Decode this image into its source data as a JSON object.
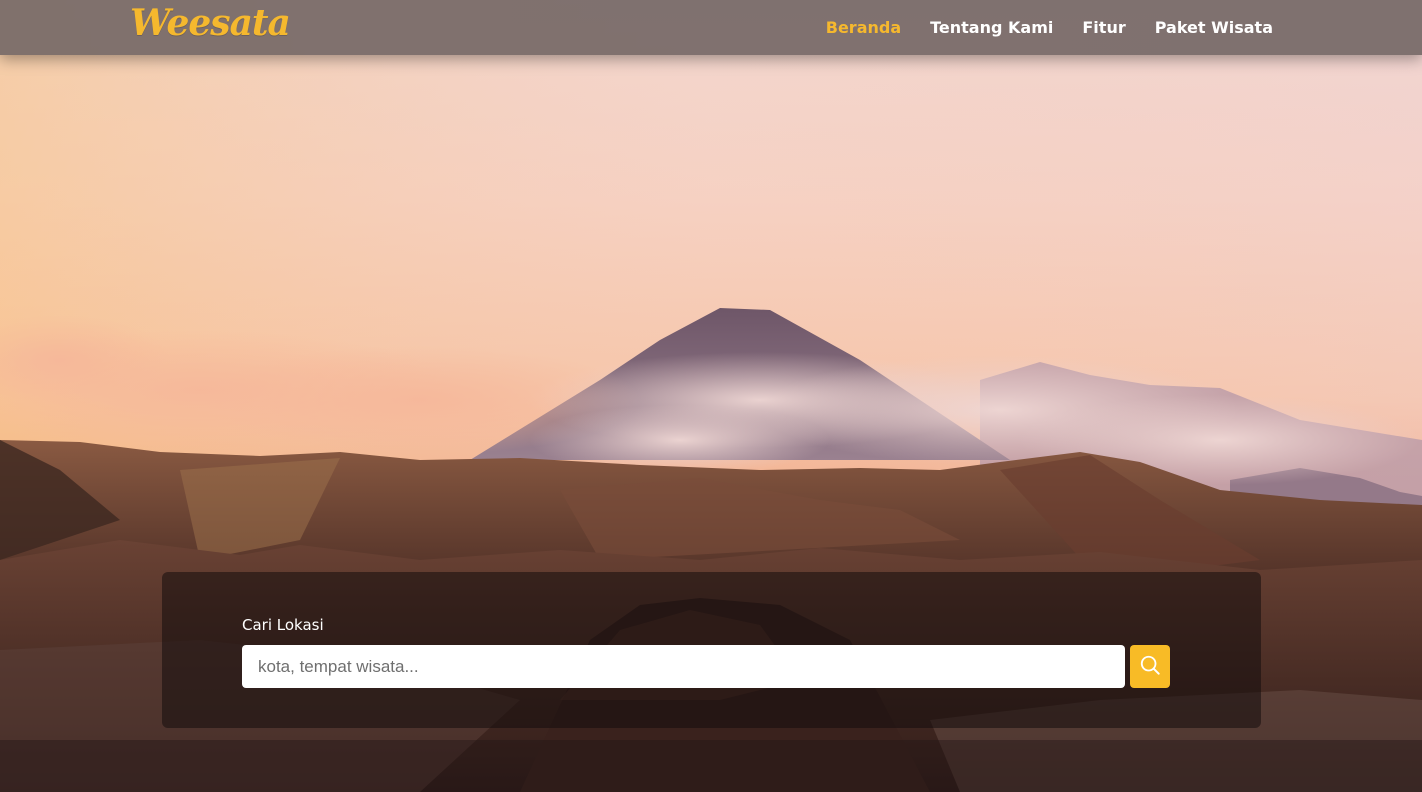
{
  "brand": {
    "logo_text": "Weesata"
  },
  "nav": {
    "items": [
      {
        "label": "Beranda",
        "active": true
      },
      {
        "label": "Tentang Kami",
        "active": false
      },
      {
        "label": "Fitur",
        "active": false
      },
      {
        "label": "Paket Wisata",
        "active": false
      }
    ]
  },
  "search": {
    "label": "Cari Lokasi",
    "placeholder": "kota, tempat wisata...",
    "value": "",
    "button_icon": "search-icon"
  },
  "colors": {
    "accent": "#f5b82e",
    "navbar_bg": "#766967",
    "button_bg": "#f8bb26"
  }
}
